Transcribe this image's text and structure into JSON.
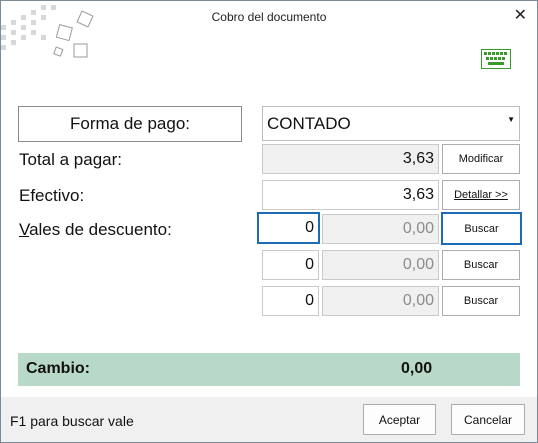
{
  "window": {
    "title": "Cobro del documento",
    "close_glyph": "✕"
  },
  "form": {
    "forma_label": "Forma de pago:",
    "forma_value": "CONTADO",
    "total_label": "Total a pagar:",
    "total_value": "3,63",
    "modificar_label": "Modificar",
    "efectivo_label": "Efectivo:",
    "efectivo_value": "3,63",
    "detallar_label": "Detallar >>",
    "vales_label_first": "V",
    "vales_label_rest": "ales de descuento:",
    "vales": [
      {
        "count": "0",
        "amount": "0,00",
        "button": "Buscar"
      },
      {
        "count": "0",
        "amount": "0,00",
        "button": "Buscar"
      },
      {
        "count": "0",
        "amount": "0,00",
        "button": "Buscar"
      }
    ]
  },
  "cambio": {
    "label": "Cambio:",
    "value": "0,00"
  },
  "footer": {
    "hint": "F1 para buscar vale",
    "accept": "Aceptar",
    "cancel": "Cancelar"
  },
  "icons": {
    "logo": "tiles-logo-icon",
    "keyboard": "keyboard-icon",
    "close": "close-icon",
    "dropdown": "chevron-down-icon"
  },
  "colors": {
    "cambio_bg": "#b8d9c8",
    "focus_border": "#1c6cb5",
    "keyboard": "#3a9a2a"
  }
}
